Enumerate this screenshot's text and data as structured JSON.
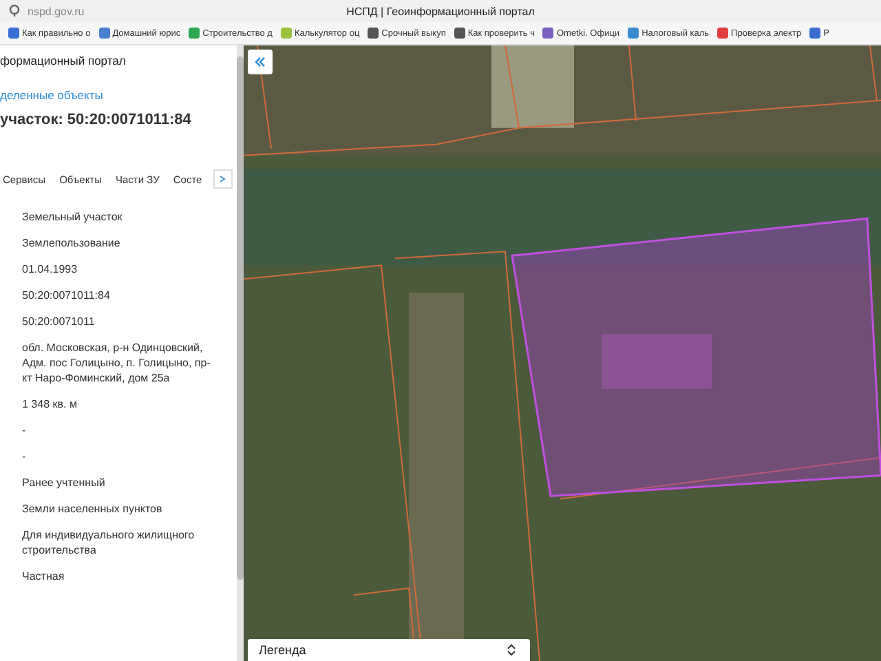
{
  "browser": {
    "address": "nspd.gov.ru",
    "title": "НСПД | Геоинформационный портал",
    "bookmarks": [
      "Как правильно о",
      "Домашний юрис",
      "Строительство д",
      "Калькулятор оц",
      "Срочный выкуп",
      "Как проверить ч",
      "Ometki. Офици",
      "Налоговый каль",
      "Проверка электр",
      "Р"
    ]
  },
  "panel": {
    "portal": "формационный портал",
    "link": "деленные объекты",
    "heading": "участок: 50:20:0071011:84",
    "tabs": [
      {
        "label": "Сервисы",
        "selected": false
      },
      {
        "label": "Объекты",
        "selected": false
      },
      {
        "label": "Части ЗУ",
        "selected": false
      },
      {
        "label": "Состе",
        "selected": false
      }
    ],
    "values": [
      "Земельный участок",
      "Землепользование",
      "01.04.1993",
      "50:20:0071011:84",
      "50:20:0071011",
      "обл. Московская, р-н Одинцовский, Адм. пос Голицыно, п. Голицыно, пр-кт Наро-Фоминский, дом 25а",
      "1 348 кв. м",
      "-",
      "-",
      "Ранее учтенный",
      "Земли населенных пунктов",
      "Для индивидуального жилищного строительства",
      "Частная"
    ]
  },
  "map": {
    "legend": "Легенда"
  }
}
